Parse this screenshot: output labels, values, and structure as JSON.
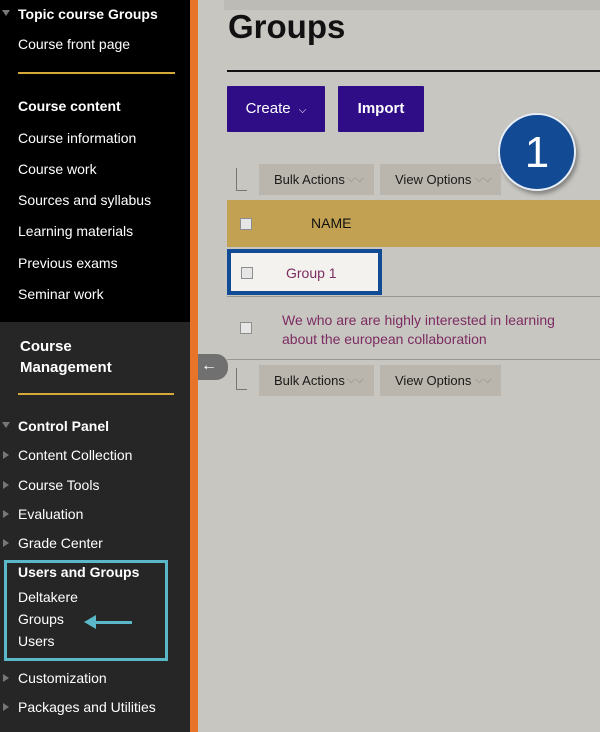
{
  "sidebar": {
    "top_section": "Topic course Groups",
    "front_page": "Course front page",
    "course_content_heading": "Course content",
    "content_items": [
      "Course information",
      "Course work",
      "Sources and syllabus",
      "Learning materials",
      "Previous exams",
      "Seminar work"
    ],
    "management_title_line1": "Course",
    "management_title_line2": "Management",
    "control_panel": "Control Panel",
    "cp_items": [
      "Content Collection",
      "Course Tools",
      "Evaluation",
      "Grade Center"
    ],
    "users_groups": "Users and Groups",
    "ug_items": [
      "Deltakere",
      "Groups",
      "Users"
    ],
    "after_items": [
      "Customization",
      "Packages and Utilities"
    ],
    "pull_tab_icon": "←"
  },
  "main": {
    "title": "Groups",
    "create_label": "Create",
    "create_chevron": "⌵",
    "import_label": "Import",
    "badge": "1",
    "bulk_actions": "Bulk Actions",
    "view_options": "View Options",
    "chevron": "⌵⌵",
    "column_name": "NAME",
    "rows": [
      "Group 1",
      "We who are are highly interested in learning about the european collaboration"
    ]
  },
  "colors": {
    "sidebar_bg": "#000000",
    "management_bg": "#262626",
    "accent_orange": "#e8742a",
    "divider_gold": "#d4a93a",
    "button_purple": "#2e0d87",
    "header_gold": "#c2a252",
    "link_purple": "#7c2c62",
    "highlight_blue": "#124a93",
    "highlight_teal": "#5bb8c8"
  }
}
